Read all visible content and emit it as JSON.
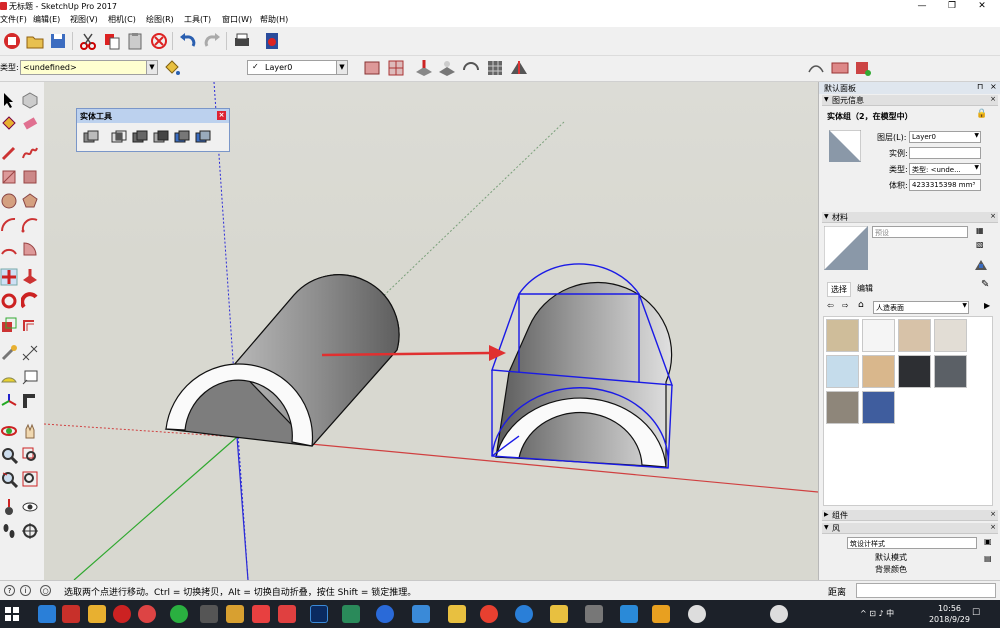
{
  "window": {
    "title": "无标题 - SketchUp Pro 2017",
    "minimize": "—",
    "maximize": "❐",
    "close": "✕"
  },
  "menu": [
    "文件(F)",
    "编辑(E)",
    "视图(V)",
    "相机(C)",
    "绘图(R)",
    "工具(T)",
    "窗口(W)",
    "帮助(H)"
  ],
  "toolbar2": {
    "type_label": "类型:",
    "type_value": "<undefined>",
    "layer_value": "Layer0",
    "layer_check": "✓"
  },
  "solid_tools": {
    "title": "实体工具",
    "close": "×"
  },
  "tray": {
    "title": "默认面板",
    "pin": "⊓",
    "close": "×",
    "entity_info": {
      "header": "图元信息",
      "entity": "实体组（2，在模型中）",
      "layer_label": "图层(L):",
      "layer_value": "Layer0",
      "instance_label": "实例:",
      "instance_value": "",
      "type_label": "类型:",
      "type_value": "类型: <unde...",
      "volume_label": "体积:",
      "volume_value": "4233315398 mm³"
    },
    "materials": {
      "header": "材料",
      "name_value": "预设",
      "tab_select": "选择",
      "tab_edit": "编辑",
      "library_value": "人造表面",
      "swatch_colors": [
        "#cfbd9a",
        "#f5f5f5",
        "#d7c2a8",
        "#e2ddd5",
        "#c5dceb",
        "#d9b78c",
        "#2d2f33",
        "#5b6066",
        "#8e867a",
        "#3f5d9e"
      ]
    },
    "components": {
      "header": "组件"
    },
    "styles": {
      "header": "风",
      "style_name": "筑设计样式",
      "style_desc": "默认模式",
      "sub": "背景颜色"
    },
    "distance_label": "距离"
  },
  "status": {
    "message": "选取两个点进行移动。Ctrl = 切换拷贝，Alt = 切换自动折叠，按住 Shift = 锁定推理。"
  },
  "taskbar": {
    "time": "10:56",
    "date": "2018/9/29",
    "tray_icons": "^ ⊡ ♪ 中"
  },
  "colors": {
    "accent": "#0000cc",
    "arrow": "#e03030"
  }
}
